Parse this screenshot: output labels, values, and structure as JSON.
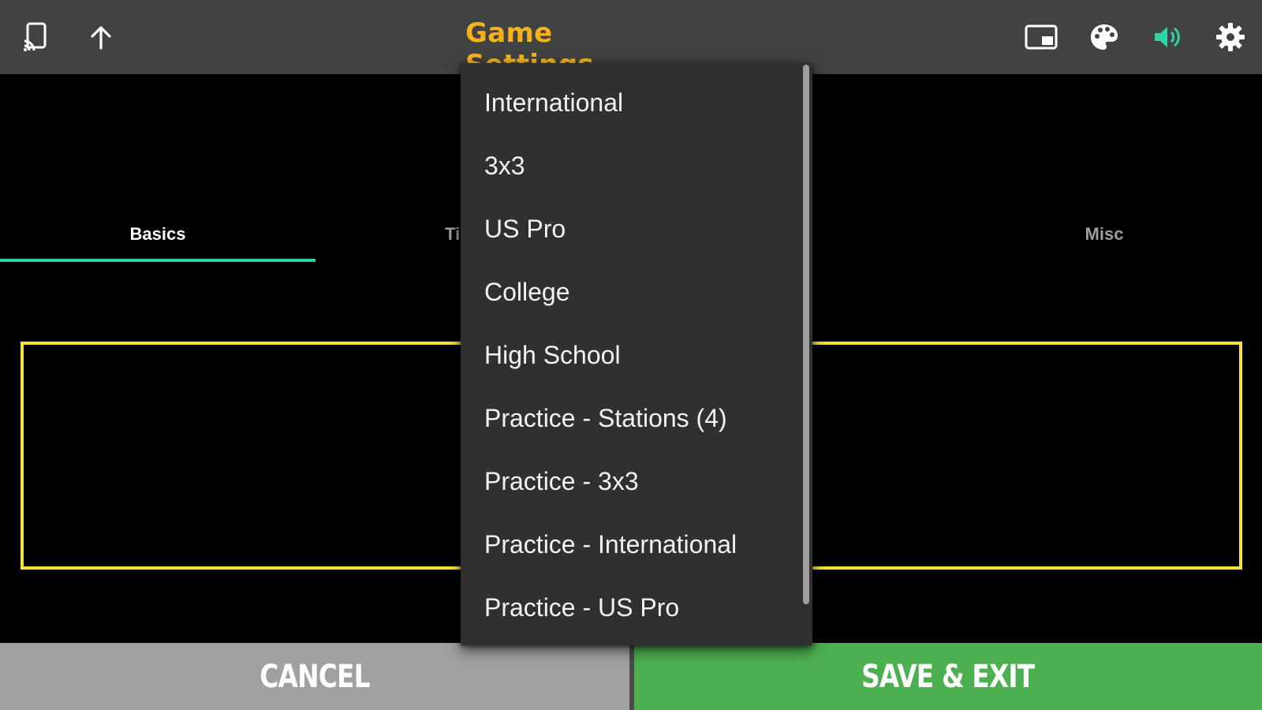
{
  "app_bar": {
    "title": "Game Settings",
    "title_color": "#f5b31b",
    "left_icons": [
      "cast-icon",
      "arrow-up-icon"
    ],
    "right_icons": [
      "picture-in-picture-icon",
      "palette-icon",
      "volume-icon",
      "gear-icon"
    ],
    "volume_icon_color": "#2fd3a6"
  },
  "tabs": [
    {
      "label": "Basics",
      "active": true
    },
    {
      "label": "Timing",
      "active": false
    },
    {
      "label": "",
      "active": false
    },
    {
      "label": "Misc",
      "active": false
    }
  ],
  "accent_color": "#2fd3a6",
  "panel_border_color": "#f6e23a",
  "dropdown": {
    "items": [
      "International",
      "3x3",
      "US Pro",
      "College",
      "High School",
      "Practice - Stations (4)",
      "Practice - 3x3",
      "Practice - International",
      "Practice - US Pro"
    ]
  },
  "buttons": {
    "cancel_label": "Cancel",
    "save_label": "Save & Exit",
    "cancel_color": "#a0a0a0",
    "save_color": "#4caf50"
  }
}
